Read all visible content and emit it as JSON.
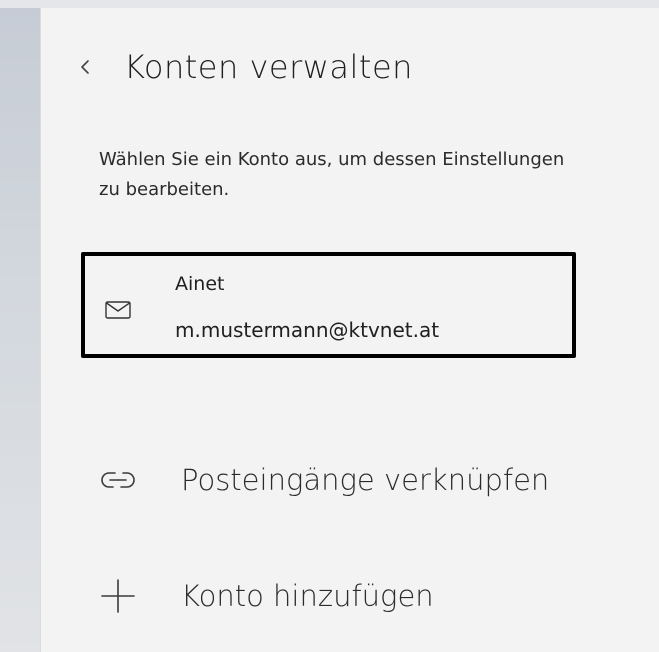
{
  "header": {
    "back_icon": "chevron-left-icon",
    "title": "Konten verwalten"
  },
  "description": "Wählen Sie ein Konto aus, um dessen Einstellungen zu bearbeiten.",
  "accounts": [
    {
      "icon": "mail-icon",
      "name": "Ainet",
      "email": "m.mustermann@ktvnet.at",
      "highlighted": true
    }
  ],
  "actions": {
    "link_inboxes": {
      "icon": "link-icon",
      "label": "Posteingänge verknüpfen"
    },
    "add_account": {
      "icon": "plus-icon",
      "label": "Konto hinzufügen"
    }
  },
  "colors": {
    "panel_background": "#f3f3f3",
    "text": "#202020",
    "highlight_border": "#000000"
  }
}
